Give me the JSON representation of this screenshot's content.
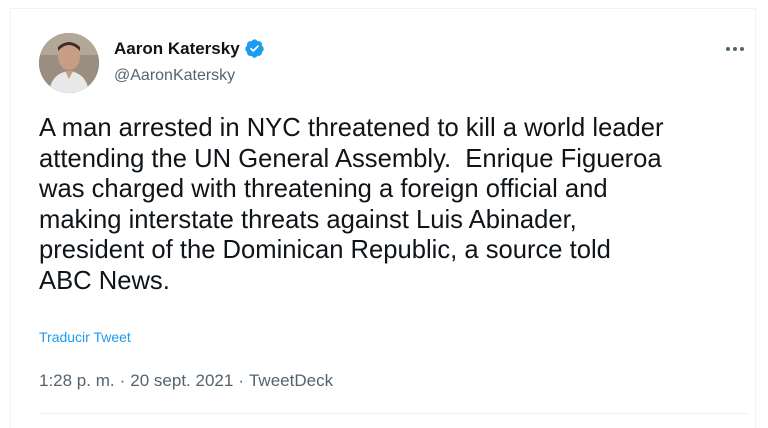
{
  "tweet": {
    "author_name": "Aaron Katersky",
    "author_handle": "@AaronKatersky",
    "verified_icon": "verified-badge-icon",
    "more_icon": "more-options-icon",
    "text": "A man arrested in NYC threatened to kill a world leader\nattending the UN General Assembly.  Enrique Figueroa\nwas charged with threatening a foreign official and\nmaking interstate threats against Luis Abinader,\npresident of the Dominican Republic, a source told\nABC News.",
    "translate_label": "Traducir Tweet",
    "time": "1:28 p. m.",
    "separator": "·",
    "date": "20 sept. 2021",
    "source": "TweetDeck"
  },
  "colors": {
    "accent": "#1d9bf0",
    "text": "#0f1419",
    "secondary_text": "#536471",
    "border": "#eff3f4"
  }
}
